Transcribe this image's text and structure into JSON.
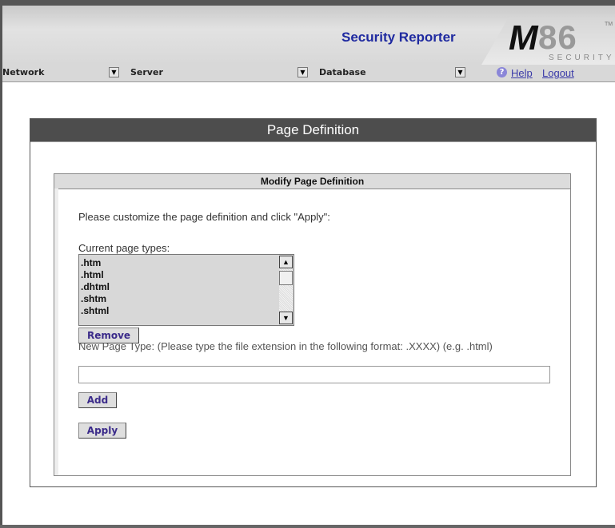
{
  "header": {
    "title": "Security Reporter",
    "logo": {
      "mark": "M",
      "number": "86",
      "tagline": "SECURITY",
      "trademark": "TM"
    }
  },
  "menubar": {
    "network": "Network",
    "server": "Server",
    "database": "Database",
    "dropdown_glyph": "▼",
    "help_icon_glyph": "?",
    "help": "Help",
    "logout": "Logout"
  },
  "panel": {
    "title": "Page Definition",
    "sub_title": "Modify Page Definition",
    "instructions": "Please customize the page definition and click \"Apply\":",
    "list_label": "Current page types:",
    "page_types": [
      ".htm",
      ".html",
      ".dhtml",
      ".shtm",
      ".shtml"
    ],
    "scroll_up_glyph": "▲",
    "scroll_down_glyph": "▼",
    "remove_label": "Remove",
    "new_type_label": "New Page Type: (Please type the file extension in the following format: .XXXX) (e.g. .html)",
    "new_type_value": "",
    "new_type_placeholder": "",
    "add_label": "Add",
    "apply_label": "Apply"
  },
  "colors": {
    "title_blue": "#1f2aa0",
    "header_dark": "#4d4d4d",
    "button_text": "#3b2b8a",
    "link": "#3a3aa8"
  }
}
